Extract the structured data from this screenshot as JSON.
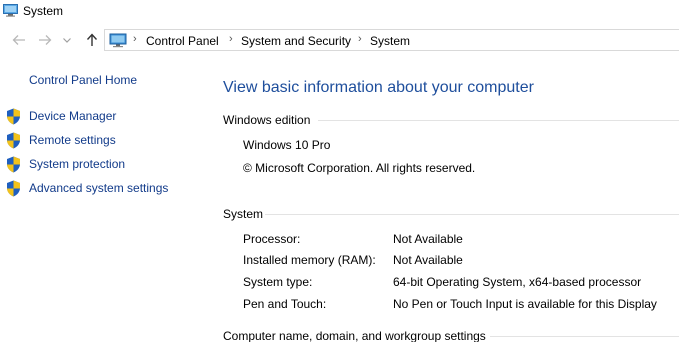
{
  "window": {
    "title": "System"
  },
  "address_bar": {
    "crumbs": [
      "Control Panel",
      "System and Security",
      "System"
    ]
  },
  "left_pane": {
    "home_link": "Control Panel Home",
    "tasks": [
      {
        "label": "Device Manager"
      },
      {
        "label": "Remote settings"
      },
      {
        "label": "System protection"
      },
      {
        "label": "Advanced system settings"
      }
    ]
  },
  "main": {
    "heading": "View basic information about your computer",
    "windows_edition": {
      "title": "Windows edition",
      "edition": "Windows 10 Pro",
      "copyright": "© Microsoft Corporation. All rights reserved."
    },
    "system": {
      "title": "System",
      "rows": [
        {
          "label": "Processor:",
          "value": "Not Available"
        },
        {
          "label": "Installed memory (RAM):",
          "value": "Not Available"
        },
        {
          "label": "System type:",
          "value": "64-bit Operating System, x64-based processor"
        },
        {
          "label": "Pen and Touch:",
          "value": "No Pen or Touch Input is available for this Display"
        }
      ]
    },
    "computer_name_section": {
      "title": "Computer name, domain, and workgroup settings"
    }
  },
  "colors": {
    "link": "#123b8a",
    "heading": "#1e4e9c",
    "shield_blue": "#1f5fbf",
    "shield_yellow": "#f2c21b"
  }
}
